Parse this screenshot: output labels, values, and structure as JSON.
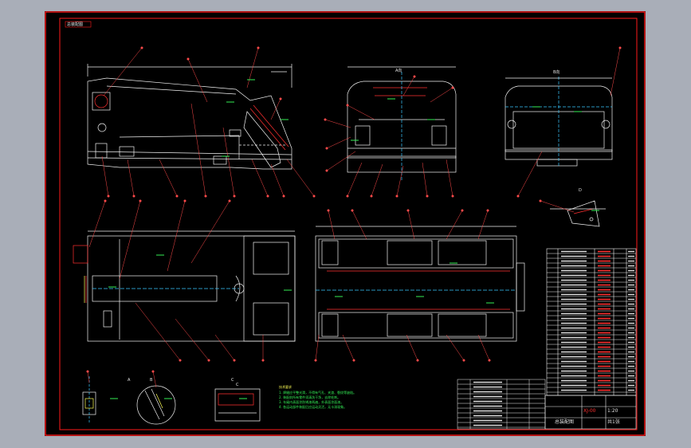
{
  "drawing": {
    "corner_tag": "总装配图",
    "detail_labels": [
      "A",
      "B",
      "C",
      "D"
    ],
    "view_labels": [
      "A向",
      "B向",
      "C"
    ],
    "tech_notes_title": "技术要求",
    "tech_notes": [
      "1. 焊缝应平整光滑，不得有气孔、夹渣、裂纹等缺陷。",
      "2. 装配前所有零件须清洗干净，去除毛刺。",
      "3. 车厢内表面涂防锈漆两遍，外表面涂面漆。",
      "4. 各运动部件装配后应运动灵活，无卡滞现象。"
    ],
    "title_block": {
      "drawing_no": "XJ-00",
      "scale": "1:20",
      "sheet": "共1张",
      "name": "总装配图"
    }
  },
  "colors": {
    "frame_bg": "#000000",
    "border": "#ff1a1a",
    "line": "#f2f2f2",
    "detail": "#ff3030",
    "center": "#38c8ff",
    "leader": "#ff4a4a",
    "note": "#33ee55",
    "accent": "#ffff55"
  }
}
